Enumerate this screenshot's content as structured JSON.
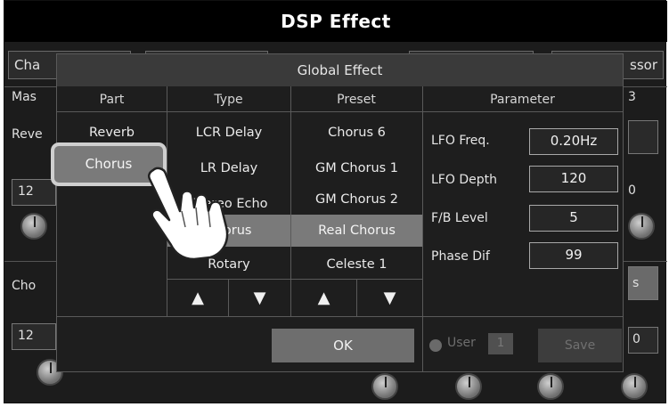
{
  "app": {
    "title": "DSP Effect"
  },
  "background": {
    "tabs": [
      "Cha",
      "",
      "",
      "",
      "ssor"
    ],
    "row_labels": [
      "Mas",
      "Reve",
      "Cho"
    ],
    "right_cells": [
      "3",
      "0",
      "s",
      "0"
    ],
    "left_values": [
      "12",
      "12"
    ]
  },
  "dialog": {
    "title": "Global Effect",
    "columns": {
      "part": "Part",
      "type": "Type",
      "preset": "Preset",
      "parameter": "Parameter"
    },
    "parts": [
      "Reverb",
      "Chorus"
    ],
    "selected_part": "Chorus",
    "types": [
      "LCR Delay",
      "LR Delay",
      "Stereo Echo",
      "Chorus",
      "Rotary"
    ],
    "selected_type": "Chorus",
    "presets": [
      "Chorus 6",
      "GM Chorus 1",
      "GM Chorus 2",
      "Real Chorus",
      "Celeste 1"
    ],
    "selected_preset": "Real Chorus",
    "parameters": [
      {
        "label": "LFO Freq.",
        "value": "0.20Hz"
      },
      {
        "label": "LFO Depth",
        "value": "120"
      },
      {
        "label": "F/B Level",
        "value": "5"
      },
      {
        "label": "Phase Dif",
        "value": "99"
      }
    ],
    "arrows": {
      "up": "▲",
      "down": "▼"
    },
    "ok_label": "OK",
    "user_label": "User",
    "user_number": "1",
    "save_label": "Save"
  },
  "colors": {
    "selected": "#7a7a7a",
    "panel": "#1e1e1e",
    "title_bar": "#000000"
  },
  "icons": [
    "hand-pointer-icon",
    "scroll-up-icon",
    "scroll-down-icon",
    "radio-dot-icon"
  ]
}
